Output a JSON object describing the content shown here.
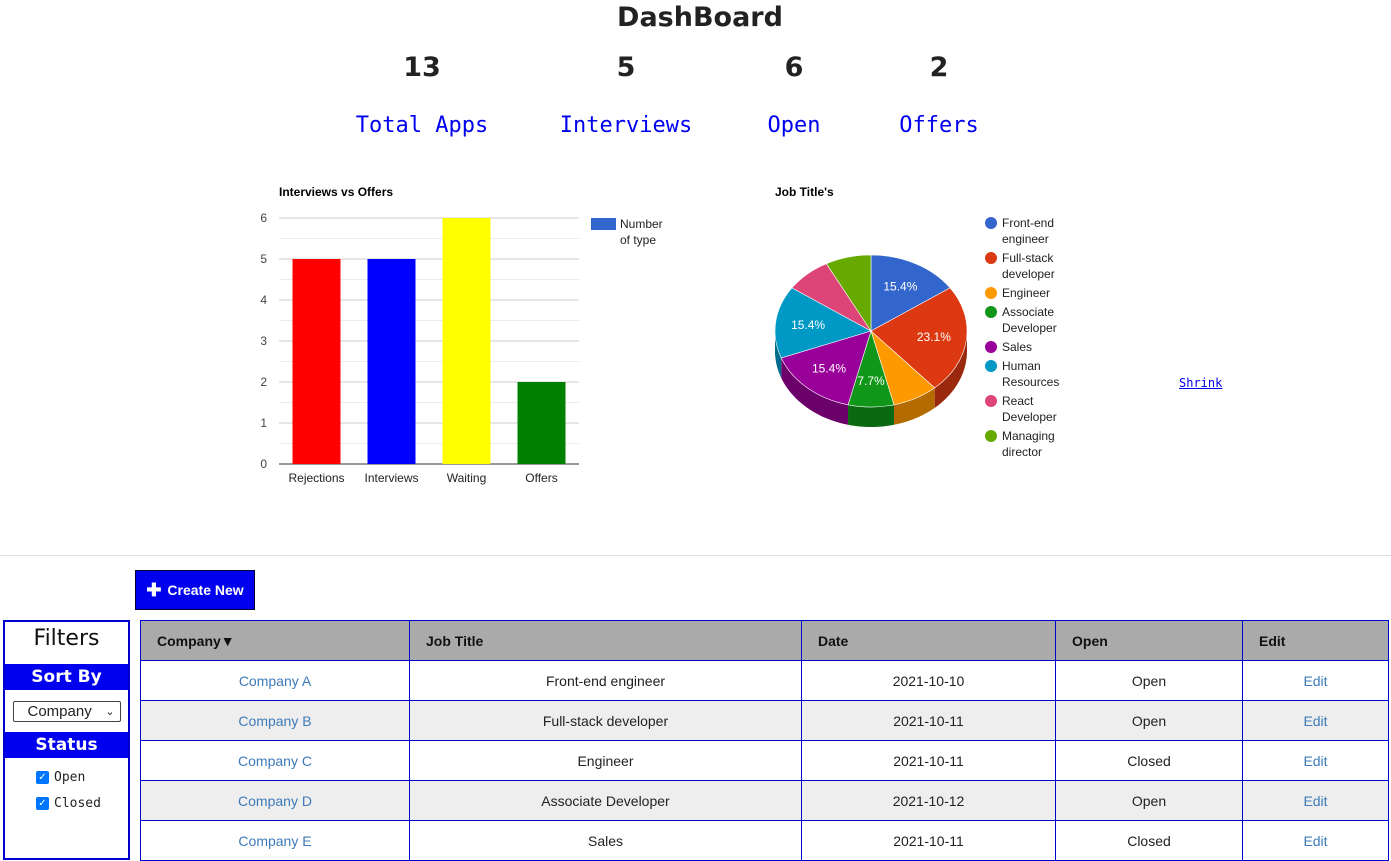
{
  "title": "DashBoard",
  "stats": [
    {
      "value": "13",
      "label": "Total Apps"
    },
    {
      "value": "5",
      "label": "Interviews"
    },
    {
      "value": "6",
      "label": "Open"
    },
    {
      "value": "2",
      "label": "Offers"
    }
  ],
  "chart_data": [
    {
      "type": "bar",
      "title": "Interviews vs Offers",
      "categories": [
        "Rejections",
        "Interviews",
        "Waiting",
        "Offers"
      ],
      "values": [
        5,
        5,
        6,
        2
      ],
      "colors": [
        "#ff0000",
        "#0000ff",
        "#ffff00",
        "#008000"
      ],
      "legend": {
        "label": "Number of type",
        "label_lines": [
          "Number",
          "of type"
        ],
        "color": "#3366cc",
        "position": "right"
      },
      "ylim": [
        0,
        6
      ],
      "yticks": [
        "0",
        "1",
        "2",
        "3",
        "4",
        "5",
        "6"
      ],
      "grid": true
    },
    {
      "type": "pie",
      "title": "Job Title's",
      "labels": [
        "Front-end engineer",
        "Full-stack developer",
        "Engineer",
        "Associate Developer",
        "Sales",
        "Human Resources",
        "React Developer",
        "Managing director"
      ],
      "legend_lines": [
        [
          "Front-end",
          "engineer"
        ],
        [
          "Full-stack",
          "developer"
        ],
        [
          "Engineer"
        ],
        [
          "Associate",
          "Developer"
        ],
        [
          "Sales"
        ],
        [
          "Human",
          "Resources"
        ],
        [
          "React",
          "Developer"
        ],
        [
          "Managing",
          "director"
        ]
      ],
      "values": [
        2,
        3,
        1,
        1,
        2,
        2,
        1,
        1
      ],
      "slice_labels": [
        "15.4%",
        "23.1%",
        "",
        "7.7%",
        "15.4%",
        "15.4%",
        "",
        ""
      ],
      "colors": [
        "#3366cc",
        "#dc3912",
        "#ff9900",
        "#109618",
        "#990099",
        "#0099c6",
        "#dd4477",
        "#66aa00"
      ],
      "legend_position": "right",
      "is3D": true
    }
  ],
  "shrink_label": "Shrink",
  "create_button": {
    "icon": "plus-icon",
    "label": "Create New"
  },
  "filters": {
    "title": "Filters",
    "sort_by_label": "Sort By",
    "sort_value": "Company",
    "status_label": "Status",
    "statuses": [
      {
        "label": "Open",
        "checked": true
      },
      {
        "label": "Closed",
        "checked": true
      }
    ]
  },
  "table": {
    "headers": [
      "Company▼",
      "Job Title",
      "Date",
      "Open",
      "Edit"
    ],
    "rows": [
      {
        "company": "Company A",
        "job": "Front-end engineer",
        "date": "2021-10-10",
        "open": "Open",
        "edit": "Edit"
      },
      {
        "company": "Company B",
        "job": "Full-stack developer",
        "date": "2021-10-11",
        "open": "Open",
        "edit": "Edit"
      },
      {
        "company": "Company C",
        "job": "Engineer",
        "date": "2021-10-11",
        "open": "Closed",
        "edit": "Edit"
      },
      {
        "company": "Company D",
        "job": "Associate Developer",
        "date": "2021-10-12",
        "open": "Open",
        "edit": "Edit"
      },
      {
        "company": "Company E",
        "job": "Sales",
        "date": "2021-10-11",
        "open": "Closed",
        "edit": "Edit"
      }
    ]
  }
}
